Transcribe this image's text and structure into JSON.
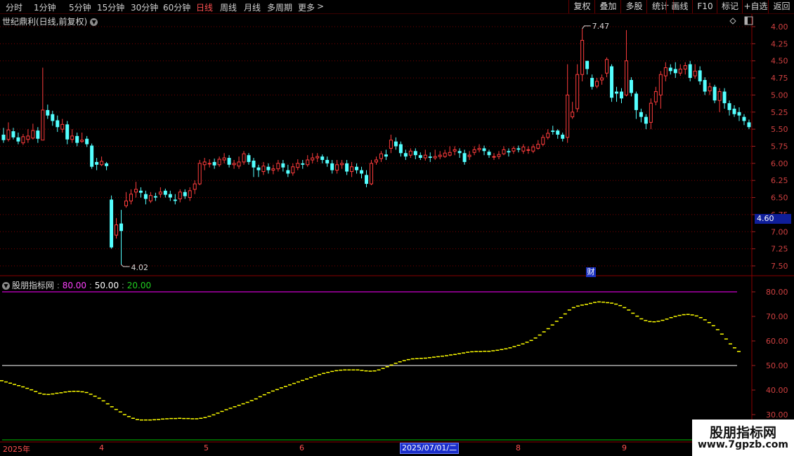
{
  "period_tabs": [
    {
      "label": "分时",
      "active": false
    },
    {
      "label": "1分钟",
      "active": false
    },
    {
      "label": "5分钟",
      "active": false
    },
    {
      "label": "15分钟",
      "active": false
    },
    {
      "label": "30分钟",
      "active": false
    },
    {
      "label": "60分钟",
      "active": false
    },
    {
      "label": "日线",
      "active": true
    },
    {
      "label": "周线",
      "active": false
    },
    {
      "label": "月线",
      "active": false
    },
    {
      "label": "多周期",
      "active": false
    },
    {
      "label": "更多",
      "active": false
    }
  ],
  "toolbar": {
    "more_arrow": ">",
    "buttons": [
      "复权",
      "叠加",
      "多股",
      "统计",
      "画线",
      "F10",
      "标记",
      "+自选",
      "返回"
    ]
  },
  "main_title": "世纪鼎利(日线,前复权)",
  "price_axis": {
    "ticks": [
      "7.50",
      "7.25",
      "7.00",
      "6.75",
      "6.50",
      "6.25",
      "6.00",
      "5.75",
      "5.50",
      "5.25",
      "5.00",
      "4.75",
      "4.50",
      "4.25",
      "4.00"
    ]
  },
  "last_price": "4.60",
  "max_label": "7.47",
  "min_label": "4.02",
  "cai_badge": "财",
  "indicator": {
    "name": "股朋指标网",
    "sep": " : ",
    "v1": "80.00",
    "v2": "50.00",
    "v3": "20.00",
    "colon": " : "
  },
  "ind_axis": {
    "ticks": [
      "80.00",
      "70.00",
      "60.00",
      "50.00",
      "40.00",
      "30.00"
    ]
  },
  "time_labels": [
    "2025年",
    "4",
    "5",
    "6",
    "8",
    "9"
  ],
  "cursor_date": "2025/07/01/二",
  "watermark": {
    "line1": "股朋指标网",
    "line2": "www.7gpzb.com"
  },
  "colors": {
    "up": "#ff3c3c",
    "down": "#54ffff",
    "line80": "#ff00ff",
    "line50": "#ffffff",
    "line20": "#00c000",
    "osc": "#ffff00",
    "grid": "#7a0000"
  },
  "chart_data": [
    {
      "type": "candlestick",
      "title": "世纪鼎利(日线,前复权)",
      "ylim": [
        3.9,
        7.6
      ],
      "yticks": [
        4.0,
        4.25,
        4.5,
        4.75,
        5.0,
        5.25,
        5.5,
        5.75,
        6.0,
        6.25,
        6.5,
        6.75,
        7.0,
        7.25,
        7.5
      ],
      "x_labels": [
        "2025年",
        "4",
        "5",
        "6",
        "8",
        "9"
      ],
      "candles": [
        [
          5.92,
          5.84,
          6.02,
          5.8
        ],
        [
          5.85,
          5.99,
          6.1,
          5.82
        ],
        [
          5.97,
          5.88,
          6.02,
          5.85
        ],
        [
          5.88,
          5.82,
          5.95,
          5.78
        ],
        [
          5.8,
          5.89,
          5.93,
          5.77
        ],
        [
          5.85,
          5.9,
          6.0,
          5.8
        ],
        [
          5.87,
          5.98,
          6.08,
          5.85
        ],
        [
          5.98,
          5.86,
          6.03,
          5.8
        ],
        [
          5.84,
          6.28,
          6.9,
          5.84
        ],
        [
          6.28,
          6.2,
          6.36,
          6.15
        ],
        [
          6.22,
          6.12,
          6.27,
          6.05
        ],
        [
          6.13,
          6.03,
          6.2,
          5.96
        ],
        [
          6.0,
          6.07,
          6.15,
          5.95
        ],
        [
          6.07,
          5.85,
          6.12,
          5.78
        ],
        [
          5.85,
          5.9,
          6.0,
          5.8
        ],
        [
          5.9,
          5.8,
          5.95,
          5.75
        ],
        [
          5.82,
          5.84,
          5.95,
          5.8
        ],
        [
          5.86,
          5.78,
          5.9,
          5.74
        ],
        [
          5.76,
          5.45,
          5.79,
          5.42
        ],
        [
          5.52,
          5.48,
          5.58,
          5.4
        ],
        [
          5.48,
          5.53,
          5.6,
          5.46
        ],
        [
          5.5,
          5.46,
          5.52,
          5.4
        ],
        [
          4.97,
          4.27,
          5.03,
          4.25
        ],
        [
          4.45,
          4.6,
          4.7,
          4.4
        ],
        [
          4.62,
          4.51,
          4.82,
          4.02
        ],
        [
          4.88,
          4.95,
          5.08,
          4.85
        ],
        [
          4.95,
          5.05,
          5.12,
          4.9
        ],
        [
          5.08,
          5.12,
          5.23,
          5.0
        ],
        [
          5.1,
          5.07,
          5.15,
          5.0
        ],
        [
          5.05,
          4.98,
          5.1,
          4.9
        ],
        [
          4.95,
          5.03,
          5.08,
          4.92
        ],
        [
          5.02,
          5.0,
          5.07,
          4.95
        ],
        [
          5.05,
          5.08,
          5.15,
          5.0
        ],
        [
          5.1,
          5.04,
          5.13,
          5.0
        ],
        [
          5.05,
          5.0,
          5.1,
          4.95
        ],
        [
          4.97,
          4.95,
          5.05,
          4.9
        ],
        [
          4.98,
          5.08,
          5.12,
          4.93
        ],
        [
          5.08,
          5.02,
          5.12,
          4.98
        ],
        [
          5.0,
          5.1,
          5.15,
          4.95
        ],
        [
          5.12,
          5.2,
          5.25,
          5.05
        ],
        [
          5.2,
          5.5,
          5.55,
          5.18
        ],
        [
          5.48,
          5.52,
          5.58,
          5.4
        ],
        [
          5.5,
          5.5,
          5.56,
          5.44
        ],
        [
          5.52,
          5.47,
          5.57,
          5.42
        ],
        [
          5.48,
          5.56,
          5.6,
          5.45
        ],
        [
          5.55,
          5.58,
          5.65,
          5.5
        ],
        [
          5.58,
          5.48,
          5.62,
          5.44
        ],
        [
          5.48,
          5.5,
          5.55,
          5.42
        ],
        [
          5.46,
          5.52,
          5.6,
          5.42
        ],
        [
          5.52,
          5.64,
          5.68,
          5.48
        ],
        [
          5.62,
          5.52,
          5.65,
          5.48
        ],
        [
          5.54,
          5.44,
          5.58,
          5.3
        ],
        [
          5.44,
          5.4,
          5.48,
          5.3
        ],
        [
          5.38,
          5.46,
          5.52,
          5.33
        ],
        [
          5.45,
          5.4,
          5.5,
          5.35
        ],
        [
          5.4,
          5.42,
          5.48,
          5.34
        ],
        [
          5.42,
          5.5,
          5.55,
          5.38
        ],
        [
          5.5,
          5.44,
          5.55,
          5.38
        ],
        [
          5.4,
          5.35,
          5.48,
          5.3
        ],
        [
          5.36,
          5.45,
          5.5,
          5.32
        ],
        [
          5.44,
          5.5,
          5.56,
          5.4
        ],
        [
          5.5,
          5.48,
          5.55,
          5.42
        ],
        [
          5.48,
          5.55,
          5.62,
          5.45
        ],
        [
          5.55,
          5.58,
          5.65,
          5.5
        ],
        [
          5.58,
          5.6,
          5.65,
          5.52
        ],
        [
          5.6,
          5.55,
          5.63,
          5.5
        ],
        [
          5.55,
          5.5,
          5.6,
          5.45
        ],
        [
          5.5,
          5.4,
          5.55,
          5.35
        ],
        [
          5.4,
          5.48,
          5.55,
          5.35
        ],
        [
          5.48,
          5.5,
          5.55,
          5.42
        ],
        [
          5.5,
          5.38,
          5.55,
          5.33
        ],
        [
          5.38,
          5.45,
          5.52,
          5.3
        ],
        [
          5.45,
          5.4,
          5.5,
          5.35
        ],
        [
          5.4,
          5.35,
          5.45,
          5.28
        ],
        [
          5.33,
          5.2,
          5.4,
          5.15
        ],
        [
          5.2,
          5.5,
          5.55,
          5.18
        ],
        [
          5.52,
          5.55,
          5.6,
          5.48
        ],
        [
          5.57,
          5.64,
          5.68,
          5.52
        ],
        [
          5.63,
          5.6,
          5.7,
          5.55
        ],
        [
          5.72,
          5.84,
          5.92,
          5.65
        ],
        [
          5.82,
          5.75,
          5.88,
          5.7
        ],
        [
          5.78,
          5.65,
          5.82,
          5.6
        ],
        [
          5.65,
          5.6,
          5.7,
          5.55
        ],
        [
          5.62,
          5.68,
          5.72,
          5.58
        ],
        [
          5.68,
          5.62,
          5.72,
          5.56
        ],
        [
          5.62,
          5.58,
          5.66,
          5.55
        ],
        [
          5.58,
          5.62,
          5.7,
          5.54
        ],
        [
          5.6,
          5.58,
          5.66,
          5.52
        ],
        [
          5.58,
          5.6,
          5.7,
          5.55
        ],
        [
          5.6,
          5.62,
          5.68,
          5.56
        ],
        [
          5.6,
          5.65,
          5.7,
          5.58
        ],
        [
          5.62,
          5.66,
          5.75,
          5.6
        ],
        [
          5.68,
          5.7,
          5.75,
          5.62
        ],
        [
          5.68,
          5.65,
          5.72,
          5.58
        ],
        [
          5.65,
          5.52,
          5.7,
          5.48
        ],
        [
          5.6,
          5.62,
          5.68,
          5.55
        ],
        [
          5.66,
          5.7,
          5.75,
          5.62
        ],
        [
          5.7,
          5.72,
          5.78,
          5.66
        ],
        [
          5.72,
          5.68,
          5.76,
          5.62
        ],
        [
          5.67,
          5.62,
          5.7,
          5.58
        ],
        [
          5.6,
          5.6,
          5.65,
          5.55
        ],
        [
          5.6,
          5.63,
          5.68,
          5.56
        ],
        [
          5.64,
          5.7,
          5.75,
          5.62
        ],
        [
          5.68,
          5.66,
          5.72,
          5.6
        ],
        [
          5.68,
          5.72,
          5.75,
          5.64
        ],
        [
          5.72,
          5.7,
          5.76,
          5.66
        ],
        [
          5.68,
          5.74,
          5.78,
          5.64
        ],
        [
          5.7,
          5.7,
          5.75,
          5.64
        ],
        [
          5.68,
          5.74,
          5.78,
          5.65
        ],
        [
          5.72,
          5.78,
          5.84,
          5.7
        ],
        [
          5.78,
          5.88,
          5.92,
          5.75
        ],
        [
          5.88,
          5.94,
          6.0,
          5.85
        ],
        [
          5.98,
          5.96,
          6.05,
          5.92
        ],
        [
          5.98,
          5.92,
          6.0,
          5.86
        ],
        [
          5.92,
          5.86,
          5.95,
          5.82
        ],
        [
          5.88,
          6.5,
          6.95,
          5.8
        ],
        [
          6.18,
          6.25,
          6.4,
          6.15
        ],
        [
          6.3,
          6.8,
          6.95,
          6.25
        ],
        [
          6.8,
          7.3,
          7.47,
          6.7
        ],
        [
          7.0,
          6.88,
          7.0,
          6.8
        ],
        [
          6.75,
          6.62,
          6.8,
          6.58
        ],
        [
          6.63,
          6.7,
          6.75,
          6.6
        ],
        [
          6.72,
          6.75,
          6.8,
          6.65
        ],
        [
          6.82,
          7.02,
          7.05,
          6.76
        ],
        [
          6.92,
          6.46,
          6.95,
          6.4
        ],
        [
          6.55,
          6.52,
          6.62,
          6.4
        ],
        [
          6.55,
          6.45,
          6.6,
          6.38
        ],
        [
          6.5,
          7.0,
          7.45,
          6.48
        ],
        [
          6.72,
          6.53,
          6.76,
          6.48
        ],
        [
          6.52,
          6.28,
          6.55,
          6.15
        ],
        [
          6.25,
          6.18,
          6.3,
          6.1
        ],
        [
          6.18,
          6.08,
          6.22,
          6.0
        ],
        [
          6.1,
          6.38,
          6.45,
          6.0
        ],
        [
          6.4,
          6.55,
          6.62,
          6.35
        ],
        [
          6.5,
          6.8,
          6.85,
          6.3
        ],
        [
          6.78,
          6.9,
          6.98,
          6.7
        ],
        [
          6.9,
          6.85,
          6.95,
          6.8
        ],
        [
          6.88,
          6.82,
          6.98,
          6.75
        ],
        [
          6.82,
          6.88,
          6.95,
          6.78
        ],
        [
          6.88,
          6.93,
          6.98,
          6.8
        ],
        [
          6.95,
          6.75,
          7.0,
          6.7
        ],
        [
          6.78,
          6.85,
          6.95,
          6.74
        ],
        [
          6.86,
          6.7,
          6.92,
          6.65
        ],
        [
          6.72,
          6.55,
          6.76,
          6.5
        ],
        [
          6.56,
          6.62,
          6.68,
          6.5
        ],
        [
          6.62,
          6.42,
          6.65,
          6.38
        ],
        [
          6.42,
          6.55,
          6.6,
          6.25
        ],
        [
          6.55,
          6.38,
          6.6,
          6.3
        ],
        [
          6.38,
          6.28,
          6.42,
          6.2
        ],
        [
          6.3,
          6.22,
          6.35,
          6.18
        ],
        [
          6.25,
          6.2,
          6.32,
          6.12
        ],
        [
          6.18,
          6.12,
          6.22,
          6.06
        ],
        [
          6.1,
          6.03,
          6.14,
          6.0
        ]
      ],
      "max_label": "7.47",
      "min_label": "4.02",
      "last_price": "4.60"
    },
    {
      "type": "line",
      "title": "股朋指标网",
      "ylim": [
        27,
        84
      ],
      "yticks": [
        30,
        40,
        50,
        60,
        70,
        80
      ],
      "reference_lines": [
        {
          "value": 80,
          "label": "80.00"
        },
        {
          "value": 50,
          "label": "50.00"
        },
        {
          "value": 20,
          "label": "20.00"
        }
      ],
      "series": [
        {
          "values": [
            43.8,
            43.3,
            42.8,
            42.3,
            41.8,
            41.3,
            40.7,
            40.1,
            39.4,
            38.7,
            38.3,
            38.2,
            38.4,
            38.7,
            38.9,
            39.2,
            39.4,
            39.5,
            39.5,
            39.3,
            39.0,
            38.3,
            37.5,
            36.7,
            35.6,
            34.4,
            33.2,
            32.1,
            31.1,
            30.0,
            29.2,
            28.5,
            28.0,
            27.8,
            27.8,
            27.8,
            27.9,
            28.0,
            28.2,
            28.3,
            28.4,
            28.4,
            28.5,
            28.4,
            28.4,
            28.3,
            28.3,
            28.5,
            28.8,
            29.3,
            29.9,
            30.6,
            31.3,
            32.0,
            32.6,
            33.2,
            33.8,
            34.4,
            35.0,
            35.7,
            36.4,
            37.3,
            38.1,
            38.9,
            39.6,
            40.2,
            40.9,
            41.5,
            42.1,
            42.7,
            43.3,
            43.9,
            44.5,
            45.1,
            45.7,
            46.3,
            46.8,
            47.2,
            47.6,
            47.9,
            48.1,
            48.2,
            48.2,
            48.2,
            48.2,
            48.0,
            47.8,
            47.7,
            47.8,
            48.2,
            48.8,
            49.5,
            50.2,
            50.9,
            51.5,
            52.0,
            52.4,
            52.7,
            52.8,
            52.9,
            53.0,
            53.2,
            53.4,
            53.6,
            53.8,
            54.0,
            54.3,
            54.5,
            54.8,
            55.1,
            55.4,
            55.6,
            55.7,
            55.7,
            55.8,
            55.8,
            56.0,
            56.2,
            56.5,
            56.8,
            57.2,
            57.7,
            58.2,
            58.8,
            59.5,
            60.2,
            61.2,
            62.4,
            63.7,
            65.0,
            66.5,
            68.0,
            69.5,
            71.0,
            72.6,
            73.6,
            74.2,
            74.6,
            74.9,
            75.3,
            75.7,
            75.9,
            75.8,
            75.6,
            75.4,
            75.0,
            74.4,
            73.6,
            72.6,
            71.3,
            70.1,
            69.0,
            68.3,
            67.9,
            67.8,
            68.0,
            68.4,
            68.9,
            69.5,
            70.0,
            70.4,
            70.7,
            70.8,
            70.6,
            70.2,
            69.5,
            68.6,
            67.5,
            66.2,
            64.6,
            62.8,
            60.8,
            58.8,
            57.2,
            55.7
          ]
        }
      ]
    }
  ]
}
